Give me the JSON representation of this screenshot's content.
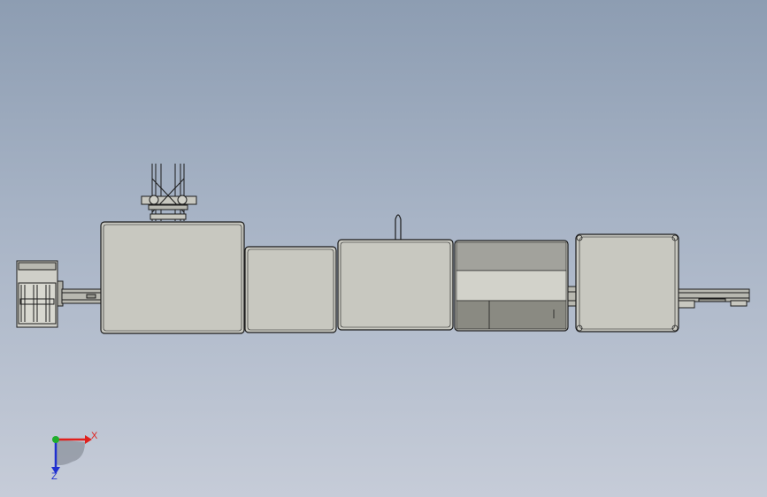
{
  "view": {
    "background_top": "#8d9db2",
    "background_bottom": "#c6ccd8"
  },
  "colors": {
    "module_fill": "#c8c8c0",
    "module_fill_light": "#cfcfc8",
    "module_fill_dark": "#8a8a82",
    "outline": "#1c1c1c",
    "rail": "#b8b8b0",
    "axis_x": "#e0201c",
    "axis_y": "#1fae2c",
    "axis_z": "#2030d0"
  },
  "triad": {
    "x_label": "X",
    "z_label": "Z"
  }
}
